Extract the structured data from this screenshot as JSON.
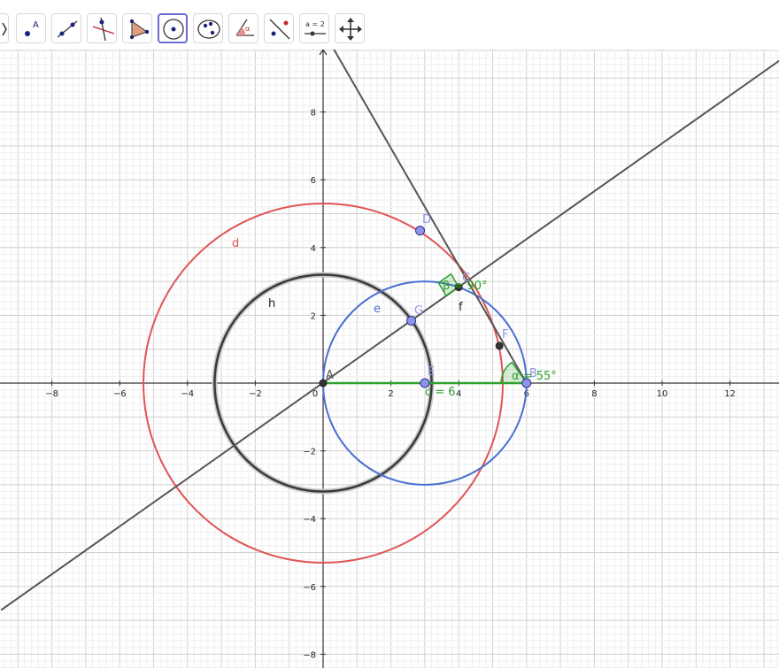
{
  "toolbar": {
    "tools": [
      {
        "name": "move-tool-partial",
        "icon": "arrow-icon"
      },
      {
        "name": "point-tool",
        "icon": "point-icon",
        "text": "A"
      },
      {
        "name": "line-tool",
        "icon": "line-icon"
      },
      {
        "name": "perpendicular-tool",
        "icon": "perpendicular-icon"
      },
      {
        "name": "polygon-tool",
        "icon": "polygon-icon"
      },
      {
        "name": "circle-center-point-tool",
        "icon": "circle-center-icon",
        "selected": true
      },
      {
        "name": "ellipse-tool",
        "icon": "ellipse-icon"
      },
      {
        "name": "angle-tool",
        "icon": "angle-icon",
        "text": "α"
      },
      {
        "name": "reflect-tool",
        "icon": "reflect-icon"
      },
      {
        "name": "slider-tool",
        "icon": "slider-icon",
        "text": "a = 2"
      },
      {
        "name": "move-graphics-tool",
        "icon": "move-graphics-icon"
      }
    ]
  },
  "graph": {
    "x_ticks": [
      -8,
      -6,
      -4,
      -2,
      0,
      2,
      4,
      6,
      8,
      10,
      12
    ],
    "y_ticks": [
      8,
      6,
      4,
      2,
      -2,
      -4,
      -6,
      -8
    ],
    "x_tick_labels": [
      "−8",
      "−6",
      "−4",
      "−2",
      "0",
      "2",
      "4",
      "6",
      "8",
      "10",
      "12"
    ],
    "y_tick_labels": [
      "8",
      "6",
      "4",
      "2",
      "−2",
      "−4",
      "−6",
      "−8"
    ],
    "colors": {
      "red": "#e05555",
      "blue": "#4a6fd0",
      "black": "#3a3a3a",
      "green": "#2ea02e",
      "point": "#8f95e6",
      "dark_point": "#333333"
    },
    "circles": [
      {
        "name": "d",
        "center": [
          0,
          0
        ],
        "r": 5.3,
        "color": "red"
      },
      {
        "name": "h",
        "center": [
          0,
          0
        ],
        "r": 3.2,
        "color": "black"
      },
      {
        "name": "e",
        "center": [
          3,
          0
        ],
        "r": 3,
        "color": "blue"
      }
    ],
    "lines": [
      {
        "name": "line-through-A-G",
        "through": [
          [
            -9.5,
            -6.7
          ],
          [
            14,
            9.9
          ]
        ]
      },
      {
        "name": "line-through-D-B",
        "through": [
          [
            -1.5,
            13
          ],
          [
            6,
            0
          ]
        ]
      }
    ],
    "segment_c": {
      "from": [
        0,
        0
      ],
      "to": [
        6,
        0
      ],
      "label": "c = 6"
    },
    "points": [
      {
        "name": "A",
        "pos": [
          0,
          0
        ],
        "kind": "dark"
      },
      {
        "name": "B",
        "pos": [
          6,
          0
        ],
        "kind": "free"
      },
      {
        "name": "D",
        "pos": [
          2.86,
          4.5
        ],
        "kind": "free"
      },
      {
        "name": "E",
        "pos": [
          3,
          0
        ],
        "kind": "free"
      },
      {
        "name": "G",
        "pos": [
          2.6,
          1.84
        ],
        "kind": "free"
      },
      {
        "name": "C",
        "pos": [
          4,
          2.83
        ],
        "kind": "dark"
      },
      {
        "name": "F",
        "pos": [
          5.2,
          1.1
        ],
        "kind": "dark"
      }
    ],
    "labels": {
      "d": "d",
      "h": "h",
      "e": "e",
      "f": "f",
      "A": "A",
      "B": "B",
      "C": "C",
      "D": "D",
      "E": "E",
      "F": "F",
      "G": "G",
      "c": "c = 6",
      "beta": "β = 90°",
      "alpha": "α = 55°"
    }
  }
}
